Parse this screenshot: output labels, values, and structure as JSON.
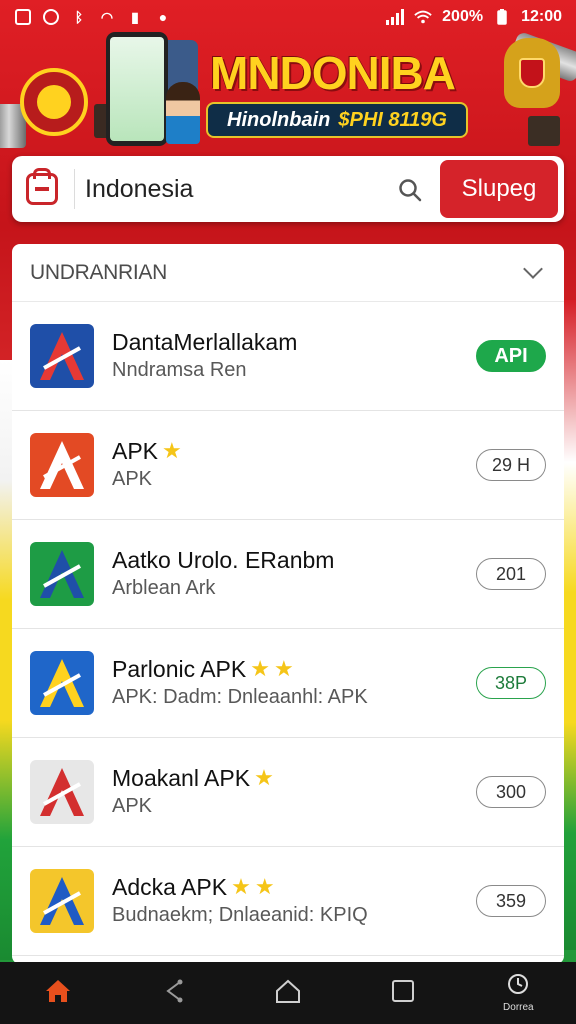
{
  "status_bar": {
    "battery": "200%",
    "time": "12:00"
  },
  "banner": {
    "title": "MNDONIBA",
    "subtitle_left": "Hinolnbain",
    "subtitle_right": "$PHI 8119G"
  },
  "search": {
    "value": "Indonesia",
    "button_label": "Slupeg"
  },
  "list": {
    "header": "UNDRANRIAN",
    "items": [
      {
        "name": "DantaMerlallakam",
        "sub": "Nndramsa Ren",
        "stars": 0,
        "badge": "API",
        "style": "primary",
        "icon_bg": "#1f4fa8",
        "icon_fg": "#e53935"
      },
      {
        "name": "APK",
        "sub": "APK",
        "stars": 1,
        "badge": "29 H",
        "style": "outline",
        "icon_bg": "#e34a24",
        "icon_fg": "#ffffff"
      },
      {
        "name": "Aatko Urolo. ERanbm",
        "sub": "Arblean Ark",
        "stars": 0,
        "badge": "201",
        "style": "outline",
        "icon_bg": "#1e9c45",
        "icon_fg": "#1f4fa8"
      },
      {
        "name": "Parlonic APK",
        "sub": "APK: Dadm: Dnleaanhl: APK",
        "stars": 2,
        "badge": "38P",
        "style": "green",
        "icon_bg": "#1f66c9",
        "icon_fg": "#ffd21f"
      },
      {
        "name": "Moakanl APK",
        "sub": "APK",
        "stars": 1,
        "badge": "300",
        "style": "outline",
        "icon_bg": "#e7e7e7",
        "icon_fg": "#d32f2f"
      },
      {
        "name": "Adcka APK",
        "sub": "Budnaekm; Dnlaeanid: KPIQ",
        "stars": 2,
        "badge": "359",
        "style": "outline",
        "icon_bg": "#f4c62b",
        "icon_fg": "#1f5bc4"
      }
    ]
  },
  "nav": {
    "last_label": "Dorrea"
  },
  "colors": {
    "accent_red": "#d5232a",
    "install_green": "#1ea84b"
  }
}
